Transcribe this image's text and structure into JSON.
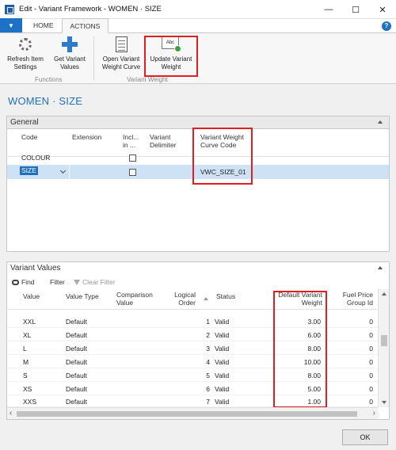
{
  "window": {
    "title": "Edit - Variant Framework - WOMEN · SIZE",
    "minimize": "—",
    "maximize": "☐",
    "close": "✕"
  },
  "ribbon": {
    "file_label": "▼",
    "tabs": [
      "HOME",
      "ACTIONS"
    ],
    "active_tab": "ACTIONS",
    "help": "?",
    "buttons": [
      {
        "label_line1": "Refresh Item",
        "label_line2": "Settings"
      },
      {
        "label_line1": "Get Variant",
        "label_line2": "Values"
      },
      {
        "label_line1": "Open Variant",
        "label_line2": "Weight Curve"
      },
      {
        "label_line1": "Update Variant",
        "label_line2": "Weight"
      }
    ],
    "groups": [
      "Functions",
      "Variant Weight"
    ]
  },
  "page_title": "WOMEN · SIZE",
  "general": {
    "title": "General",
    "columns": {
      "code": "Code",
      "extension": "Extension",
      "include_line1": "Incl...",
      "include_line2": "in ...",
      "delimiter_line1": "Variant",
      "delimiter_line2": "Delimiter",
      "curve_line1": "Variant Weight",
      "curve_line2": "Curve Code"
    },
    "rows": [
      {
        "code": "COLOUR",
        "included": false,
        "curve_code": ""
      },
      {
        "code": "SIZE",
        "included": false,
        "curve_code": "VWC_SIZE_01"
      }
    ]
  },
  "variant_values": {
    "title": "Variant Values",
    "toolbar": {
      "find": "Find",
      "filter": "Filter",
      "clear_filter": "Clear Filter"
    },
    "columns": {
      "value": "Value",
      "value_type": "Value Type",
      "comparison_line1": "Comparison",
      "comparison_line2": "Value",
      "logical_line1": "Logical",
      "logical_line2": "Order",
      "status": "Status",
      "weight_line1": "Default Variant",
      "weight_line2": "Weight",
      "fuel_line1": "Fuel Price",
      "fuel_line2": "Group Id"
    },
    "rows": [
      {
        "value": "XXL",
        "type": "Default",
        "order": "1",
        "status": "Valid",
        "weight": "3.00",
        "fuel": "0"
      },
      {
        "value": "XL",
        "type": "Default",
        "order": "2",
        "status": "Valid",
        "weight": "6.00",
        "fuel": "0"
      },
      {
        "value": "L",
        "type": "Default",
        "order": "3",
        "status": "Valid",
        "weight": "8.00",
        "fuel": "0"
      },
      {
        "value": "M",
        "type": "Default",
        "order": "4",
        "status": "Valid",
        "weight": "10.00",
        "fuel": "0"
      },
      {
        "value": "S",
        "type": "Default",
        "order": "5",
        "status": "Valid",
        "weight": "8.00",
        "fuel": "0"
      },
      {
        "value": "XS",
        "type": "Default",
        "order": "6",
        "status": "Valid",
        "weight": "5.00",
        "fuel": "0"
      },
      {
        "value": "XXS",
        "type": "Default",
        "order": "7",
        "status": "Valid",
        "weight": "1.00",
        "fuel": "0"
      }
    ]
  },
  "footer": {
    "ok_label": "OK"
  },
  "colors": {
    "accent": "#1f6fbf",
    "highlight": "#e02020",
    "selected_row": "#cde3f5"
  }
}
